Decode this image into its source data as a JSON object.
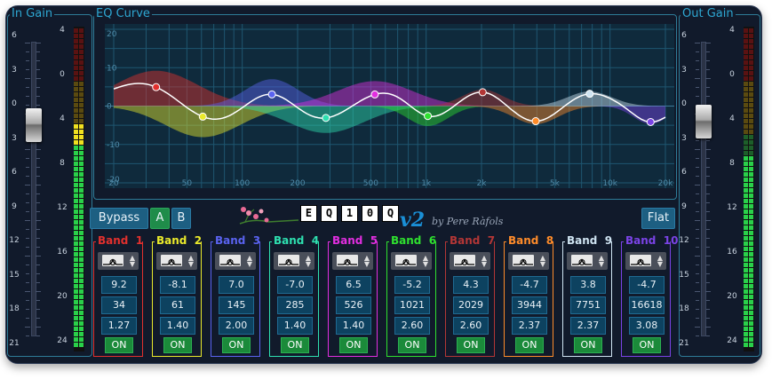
{
  "in_gain": {
    "label": "In Gain",
    "scale_left": [
      "6",
      "3",
      "0",
      "3",
      "6",
      "9",
      "12",
      "15",
      "18",
      "21"
    ],
    "scale_meter": [
      "4",
      "0",
      "4",
      "8",
      "12",
      "16",
      "20",
      "24"
    ]
  },
  "out_gain": {
    "label": "Out Gain",
    "scale_left": [
      "6",
      "3",
      "0",
      "3",
      "6",
      "9",
      "12",
      "15",
      "18",
      "21"
    ],
    "scale_meter": [
      "4",
      "0",
      "4",
      "8",
      "12",
      "16",
      "20",
      "24"
    ]
  },
  "eq_curve": {
    "label": "EQ Curve",
    "y_ticks": [
      "20",
      "10",
      "0",
      "-10",
      "-20"
    ],
    "x_ticks": [
      "20",
      "50",
      "100",
      "200",
      "500",
      "1k",
      "2k",
      "5k",
      "10k",
      "20k"
    ]
  },
  "toolbar": {
    "bypass_label": "Bypass",
    "a_label": "A",
    "b_label": "B",
    "flat_label": "Flat"
  },
  "brand": {
    "logo_letters": [
      "E",
      "Q",
      "1",
      "0",
      "Q"
    ],
    "version": "v2",
    "author": "by Pere Ràfols"
  },
  "bands": [
    {
      "title": "Band  1",
      "gain": "9.2",
      "freq": "34",
      "q": "1.27",
      "on": "ON",
      "color": "#e2302d"
    },
    {
      "title": "Band  2",
      "gain": "-8.1",
      "freq": "61",
      "q": "1.40",
      "on": "ON",
      "color": "#eaea2b"
    },
    {
      "title": "Band  3",
      "gain": "7.0",
      "freq": "145",
      "q": "2.00",
      "on": "ON",
      "color": "#5a63f0"
    },
    {
      "title": "Band  4",
      "gain": "-7.0",
      "freq": "285",
      "q": "1.40",
      "on": "ON",
      "color": "#2ee0b0"
    },
    {
      "title": "Band  5",
      "gain": "6.5",
      "freq": "526",
      "q": "1.40",
      "on": "ON",
      "color": "#e22ee0"
    },
    {
      "title": "Band  6",
      "gain": "-5.2",
      "freq": "1021",
      "q": "2.60",
      "on": "ON",
      "color": "#2fe02f"
    },
    {
      "title": "Band  7",
      "gain": "4.3",
      "freq": "2029",
      "q": "2.60",
      "on": "ON",
      "color": "#b33636"
    },
    {
      "title": "Band  8",
      "gain": "-4.7",
      "freq": "3944",
      "q": "2.37",
      "on": "ON",
      "color": "#ff8c2a"
    },
    {
      "title": "Band  9",
      "gain": "3.8",
      "freq": "7751",
      "q": "2.37",
      "on": "ON",
      "color": "#cfe4f2"
    },
    {
      "title": "Band  10",
      "gain": "-4.7",
      "freq": "16618",
      "q": "3.08",
      "on": "ON",
      "color": "#7a43e6"
    }
  ],
  "icons": {
    "filter_type": "peak-filter-icon",
    "spin": "up-down-arrows-icon",
    "logo_flowers": "flower-decoration-icon"
  }
}
